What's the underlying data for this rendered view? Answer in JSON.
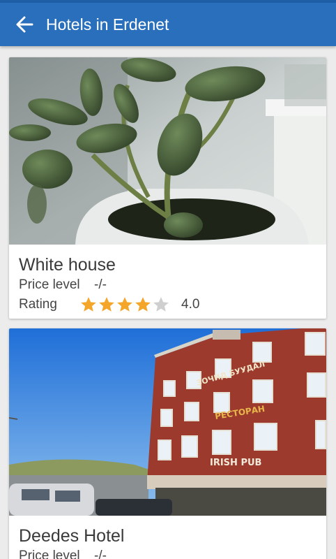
{
  "appbar": {
    "title": "Hotels in Erdenet",
    "back_icon": "arrow-left-icon"
  },
  "colors": {
    "appbar": "#2a6fbb",
    "star_filled": "#f4a62a",
    "star_empty": "#cfcfcf"
  },
  "hotels": [
    {
      "name": "White house",
      "price_label": "Price level",
      "price_value": "-/-",
      "rating_label": "Rating",
      "rating": 4,
      "rating_max": 5,
      "rating_text": "4.0"
    },
    {
      "name": "Deedes Hotel",
      "price_label": "Price level",
      "price_value": "-/-",
      "sign_lines": [
        "ЗОЧИД БУУДАЛ",
        "РЕСТОРАН",
        "IRISH PUB"
      ]
    }
  ]
}
